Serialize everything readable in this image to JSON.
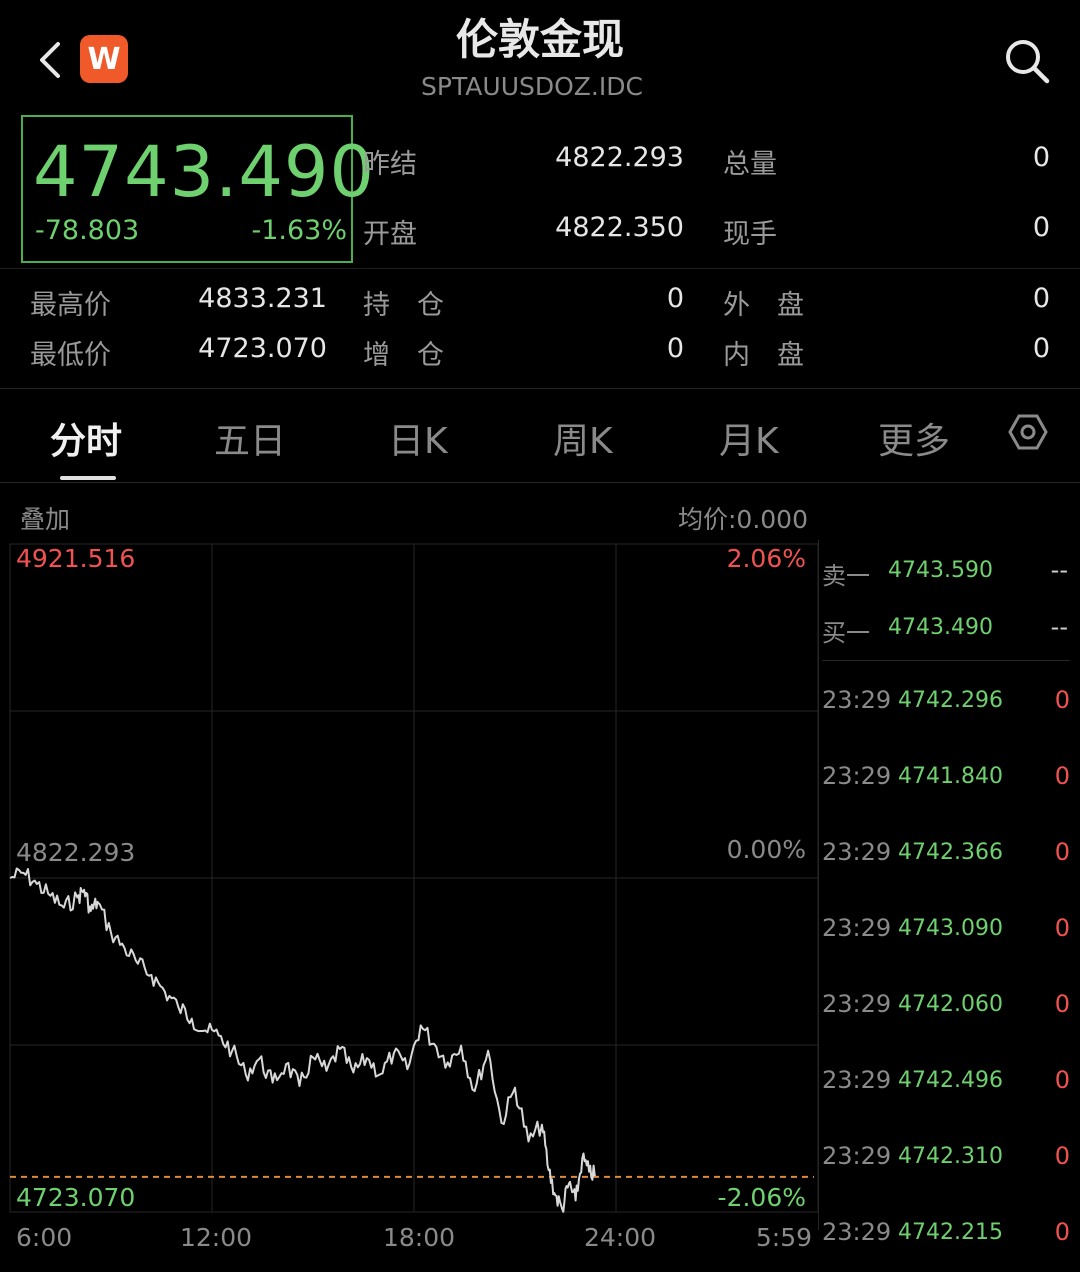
{
  "header": {
    "title": "伦敦金现",
    "subtitle": "SPTAUUSDOZ.IDC",
    "logo_letter": "W"
  },
  "quote": {
    "price": "4743.490",
    "change": "-78.803",
    "change_pct": "-1.63%"
  },
  "stats_top": [
    {
      "label": "昨结",
      "value": "4822.293",
      "label2": "总量",
      "value2": "0"
    },
    {
      "label": "开盘",
      "value": "4822.350",
      "label2": "现手",
      "value2": "0"
    }
  ],
  "stats_bottom": [
    {
      "label": "最高价",
      "value": "4833.231",
      "label2": "持　仓",
      "value2": "0",
      "label3": "外　盘",
      "value3": "0"
    },
    {
      "label": "最低价",
      "value": "4723.070",
      "label2": "增　仓",
      "value2": "0",
      "label3": "内　盘",
      "value3": "0"
    }
  ],
  "tabs": [
    "分时",
    "五日",
    "日K",
    "周K",
    "月K",
    "更多"
  ],
  "chart": {
    "overlay_label": "叠加",
    "avg_label": "均价:0.000",
    "top_price": "4921.516",
    "top_pct": "2.06%",
    "mid_price": "4822.293",
    "mid_pct": "0.00%",
    "bottom_price": "4723.070",
    "bottom_pct": "-2.06%",
    "x_ticks": [
      "6:00",
      "12:00",
      "18:00",
      "24:00",
      "5:59"
    ]
  },
  "order_book": [
    {
      "label": "卖一",
      "price": "4743.590",
      "vol": "--"
    },
    {
      "label": "买一",
      "price": "4743.490",
      "vol": "--"
    }
  ],
  "trades": [
    {
      "time": "23:29",
      "price": "4742.296",
      "vol": "0"
    },
    {
      "time": "23:29",
      "price": "4741.840",
      "vol": "0"
    },
    {
      "time": "23:29",
      "price": "4742.366",
      "vol": "0"
    },
    {
      "time": "23:29",
      "price": "4743.090",
      "vol": "0"
    },
    {
      "time": "23:29",
      "price": "4742.060",
      "vol": "0"
    },
    {
      "time": "23:29",
      "price": "4742.496",
      "vol": "0"
    },
    {
      "time": "23:29",
      "price": "4742.310",
      "vol": "0"
    },
    {
      "time": "23:29",
      "price": "4742.215",
      "vol": "0"
    }
  ],
  "chart_data": {
    "type": "line",
    "x_unit": "hours since 6:00 session open",
    "x": [
      0,
      0.4,
      0.8,
      1.2,
      1.6,
      2.0,
      2.2,
      2.4,
      2.6,
      3.0,
      3.4,
      3.8,
      4.2,
      4.6,
      5.0,
      5.4,
      5.8,
      6.2,
      6.6,
      7.0,
      7.4,
      7.8,
      8.2,
      8.6,
      9.0,
      9.4,
      9.8,
      10.2,
      10.6,
      11.0,
      11.4,
      11.8,
      12.2,
      12.6,
      13.0,
      13.4,
      13.8,
      14.2,
      14.6,
      15.0,
      15.4,
      15.8,
      16.0,
      16.2,
      16.4,
      16.6,
      16.8,
      17.0,
      17.2,
      17.4
    ],
    "values": [
      4822.3,
      4823.8,
      4820.5,
      4817.0,
      4813.5,
      4816.5,
      4818.8,
      4812.5,
      4815.2,
      4806.0,
      4801.5,
      4796.8,
      4793.5,
      4788.5,
      4784.0,
      4780.5,
      4777.0,
      4775.5,
      4771.0,
      4764.0,
      4768.5,
      4761.5,
      4767.0,
      4760.5,
      4769.0,
      4765.0,
      4771.5,
      4764.5,
      4768.8,
      4764.0,
      4770.2,
      4765.5,
      4778.5,
      4773.0,
      4767.5,
      4772.5,
      4759.0,
      4771.0,
      4749.5,
      4760.0,
      4744.0,
      4749.0,
      4735.5,
      4728.0,
      4724.0,
      4731.5,
      4726.5,
      4739.0,
      4735.0,
      4734.0
    ],
    "ylim": [
      4723.07,
      4921.516
    ],
    "xlim": [
      0,
      24
    ],
    "baseline": 4822.293,
    "low_line": 4733.5,
    "grid": true,
    "line_color": "#d8d8d8",
    "low_line_color": "#e08a3a"
  }
}
